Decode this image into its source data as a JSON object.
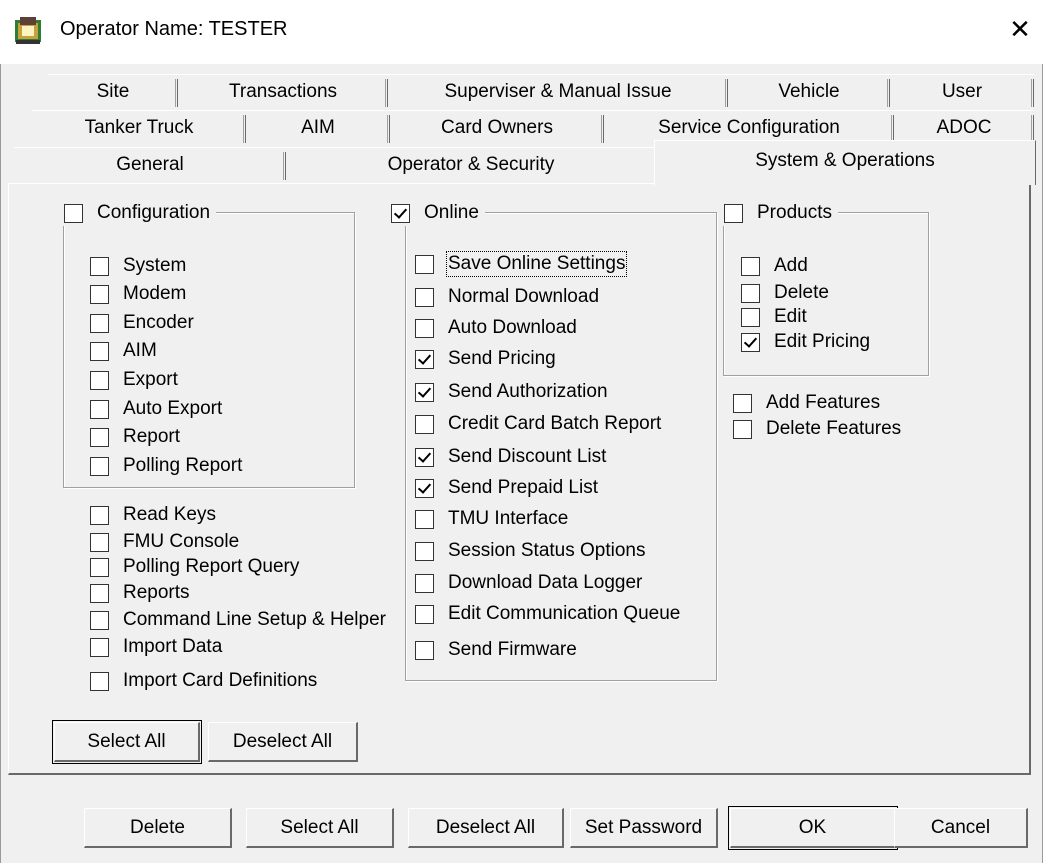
{
  "window": {
    "title": "Operator Name: TESTER",
    "close_glyph": "✕"
  },
  "tabs": {
    "row1": [
      "Site",
      "Transactions",
      "Superviser & Manual Issue",
      "Vehicle",
      "User"
    ],
    "row2": [
      "Tanker Truck",
      "AIM",
      "Card Owners",
      "Service Configuration",
      "ADOC"
    ],
    "row3": [
      "General",
      "Operator & Security",
      "System & Operations"
    ],
    "active": "System & Operations"
  },
  "configuration": {
    "label": "Configuration",
    "checked": false,
    "items": [
      {
        "label": "System",
        "checked": false
      },
      {
        "label": "Modem",
        "checked": false
      },
      {
        "label": "Encoder",
        "checked": false
      },
      {
        "label": "AIM",
        "checked": false
      },
      {
        "label": "Export",
        "checked": false
      },
      {
        "label": "Auto Export",
        "checked": false
      },
      {
        "label": "Report",
        "checked": false
      },
      {
        "label": "Polling Report",
        "checked": false
      }
    ]
  },
  "misc": [
    {
      "label": "Read Keys",
      "checked": false
    },
    {
      "label": "FMU Console",
      "checked": false
    },
    {
      "label": "Polling Report Query",
      "checked": false
    },
    {
      "label": "Reports",
      "checked": false
    },
    {
      "label": "Command Line Setup & Helper",
      "checked": false
    },
    {
      "label": "Import Data",
      "checked": false
    },
    {
      "label": "Import Card Definitions",
      "checked": false
    }
  ],
  "online": {
    "label": "Online",
    "checked": true,
    "items": [
      {
        "label": "Save Online Settings",
        "checked": false
      },
      {
        "label": "Normal Download",
        "checked": false
      },
      {
        "label": "Auto Download",
        "checked": false
      },
      {
        "label": "Send Pricing",
        "checked": true
      },
      {
        "label": "Send Authorization",
        "checked": true
      },
      {
        "label": "Credit Card Batch Report",
        "checked": false
      },
      {
        "label": "Send Discount List",
        "checked": true
      },
      {
        "label": "Send Prepaid List",
        "checked": true
      },
      {
        "label": "TMU Interface",
        "checked": false
      },
      {
        "label": "Session Status Options",
        "checked": false
      },
      {
        "label": "Download Data Logger",
        "checked": false
      },
      {
        "label": "Edit Communication Queue",
        "checked": false
      },
      {
        "label": "Send Firmware",
        "checked": false
      }
    ]
  },
  "products": {
    "label": "Products",
    "checked": false,
    "items": [
      {
        "label": "Add",
        "checked": false
      },
      {
        "label": "Delete",
        "checked": false
      },
      {
        "label": "Edit",
        "checked": false
      },
      {
        "label": "Edit Pricing",
        "checked": true
      }
    ]
  },
  "features": [
    {
      "label": "Add Features",
      "checked": false
    },
    {
      "label": "Delete Features",
      "checked": false
    }
  ],
  "panel_buttons": {
    "select_all": "Select All",
    "deselect_all": "Deselect All"
  },
  "footer_buttons": {
    "delete": "Delete",
    "select_all": "Select All",
    "deselect_all": "Deselect All",
    "set_password": "Set Password",
    "ok": "OK",
    "cancel": "Cancel"
  }
}
